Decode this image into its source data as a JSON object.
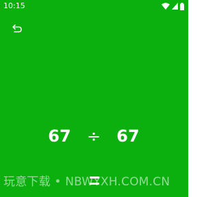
{
  "colors": {
    "background": "#0bb00f",
    "foreground": "#ffffff"
  },
  "status_bar": {
    "time": "10:15",
    "icons": [
      "wifi-icon",
      "signal-icon",
      "battery-icon"
    ]
  },
  "toolbar": {
    "back_icon": "back-arrow-icon"
  },
  "equation": {
    "left_operand": "67",
    "operator": "÷",
    "right_operand": "67"
  },
  "watermark": {
    "text": "玩意下载 • NBWYXH.COM.CN"
  }
}
